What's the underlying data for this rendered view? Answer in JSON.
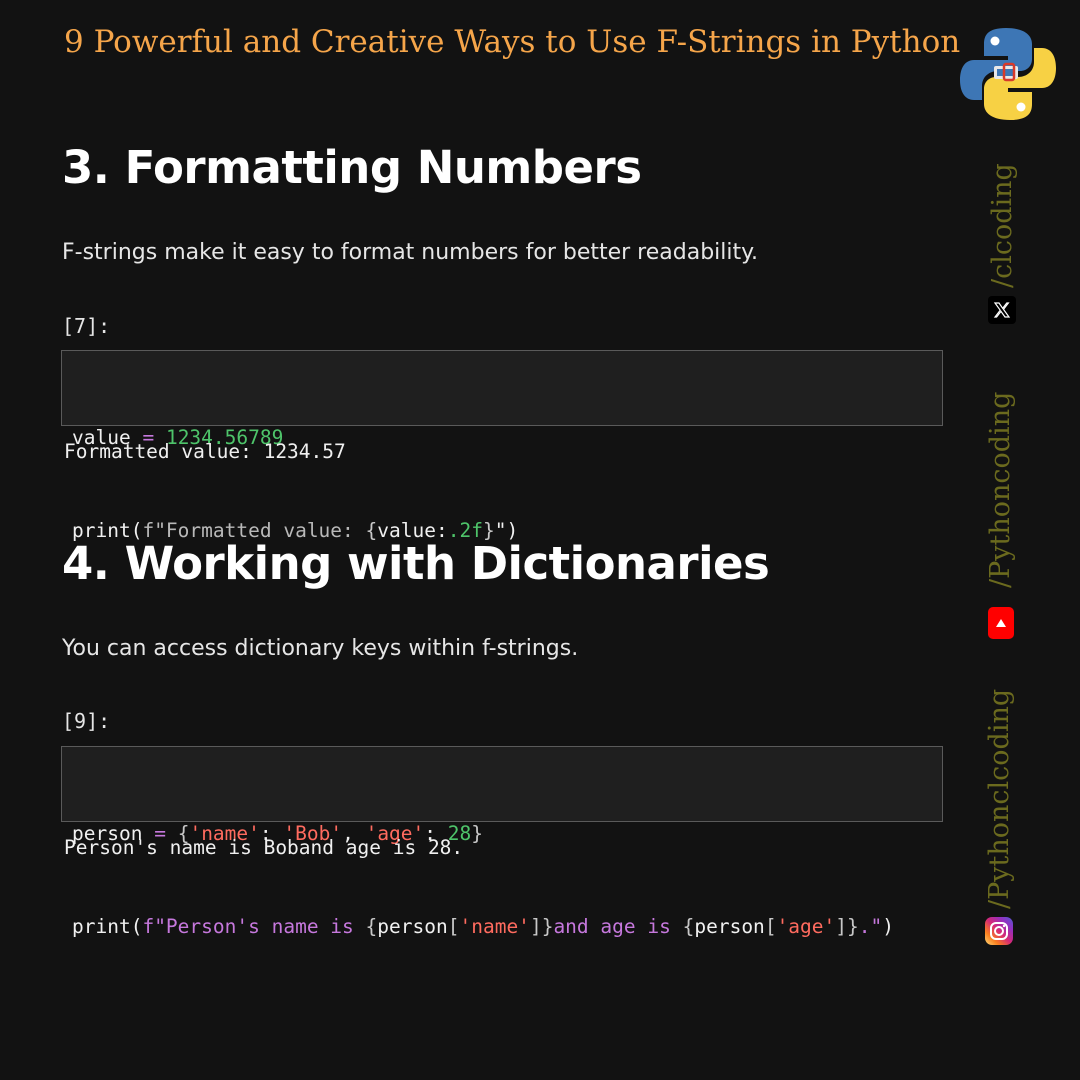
{
  "header": {
    "title": "9 Powerful and Creative Ways to Use F-Strings in Python",
    "logo_icon": "python-logo-icon"
  },
  "section3": {
    "heading": "3. Formatting Numbers",
    "description": "F-strings make it easy to format numbers for better readability.",
    "prompt": "[7]:",
    "code": {
      "line1": {
        "name": "value",
        "op": "=",
        "number": "1234.56789"
      },
      "line2": {
        "func": "print(",
        "prefix": "f\"Formatted value: ",
        "brace_open": "{",
        "expr": "value:",
        "fmt": ".2f",
        "brace_close": "}",
        "suffix": "\")"
      }
    },
    "output": "Formatted value: 1234.57"
  },
  "section4": {
    "heading": "4. Working with Dictionaries",
    "description": "You can access dictionary keys within f-strings.",
    "prompt": "[9]:",
    "code": {
      "line1": {
        "name": "person",
        "op": "=",
        "brace_open": "{",
        "key1": "'name'",
        "colon1": ": ",
        "val1": "'Bob'",
        "comma": ", ",
        "key2": "'age'",
        "colon2": ": ",
        "val2": "28",
        "brace_close": "}"
      },
      "line2": {
        "func": "print(",
        "prefix": "f\"Person's name ",
        "kw_is1": "is",
        "space1": " ",
        "brace1_open": "{",
        "obj1": "person",
        "bracket1_open": "[",
        "key1": "'name'",
        "bracket1_close": "]",
        "brace1_close": "}",
        "mid_and": "and ",
        "mid_age": "age ",
        "kw_is2": "is",
        "space2": " ",
        "brace2_open": "{",
        "obj2": "person",
        "bracket2_open": "[",
        "key2": "'age'",
        "bracket2_close": "]",
        "brace2_close": "}",
        "suffix_str": ".\"",
        "close_paren": ")"
      }
    },
    "output": "Person's name is Boband age is 28."
  },
  "social": {
    "x_handle": "/clcoding",
    "x_icon": "x-icon",
    "youtube_handle": "/Pythoncoding",
    "youtube_icon": "youtube-icon",
    "instagram_handle": "/Pythonclcoding",
    "instagram_icon": "instagram-icon"
  },
  "colors": {
    "background": "#121212",
    "title_accent": "#f5a54a",
    "side_text": "#6b6a1e",
    "operator": "#c678dd",
    "number": "#4ec46a",
    "dict_string": "#ff6b5f"
  }
}
